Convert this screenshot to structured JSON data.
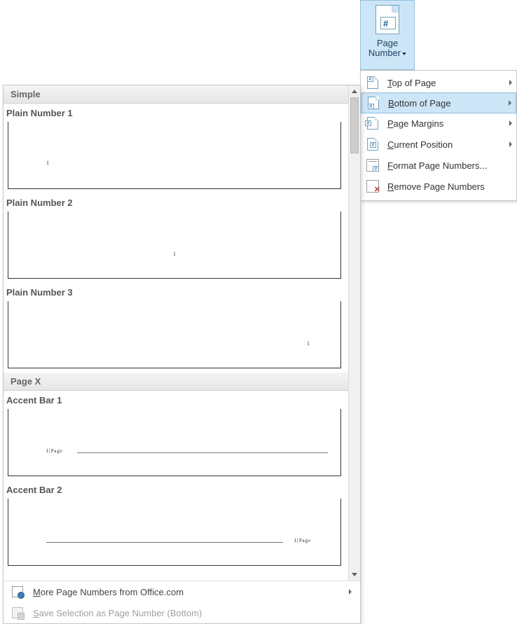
{
  "ribbon": {
    "button_line1": "Page",
    "button_line2": "Number",
    "icon_hash": "#"
  },
  "menu": {
    "items": [
      {
        "label": "Top of Page",
        "accel_index": 0,
        "submenu": true,
        "icon": "page-top"
      },
      {
        "label": "Bottom of Page",
        "accel_index": 0,
        "submenu": true,
        "icon": "page-bottom",
        "highlighted": true
      },
      {
        "label": "Page Margins",
        "accel_index": 0,
        "submenu": true,
        "icon": "page-margin"
      },
      {
        "label": "Current Position",
        "accel_index": 0,
        "submenu": true,
        "icon": "page-current"
      },
      {
        "label": "Format Page Numbers...",
        "accel_index": 0,
        "submenu": false,
        "icon": "format"
      },
      {
        "label": "Remove Page Numbers",
        "accel_index": 0,
        "submenu": false,
        "icon": "remove"
      }
    ]
  },
  "gallery": {
    "sections": [
      {
        "header": "Simple",
        "items": [
          {
            "title": "Plain Number 1",
            "style": "plain-left",
            "sample": "1"
          },
          {
            "title": "Plain Number 2",
            "style": "plain-center",
            "sample": "1"
          },
          {
            "title": "Plain Number 3",
            "style": "plain-right",
            "sample": "1"
          }
        ]
      },
      {
        "header": "Page X",
        "items": [
          {
            "title": "Accent Bar 1",
            "style": "accent-left",
            "sample": "1|Page"
          },
          {
            "title": "Accent Bar 2",
            "style": "accent-right",
            "sample": "1|Page"
          }
        ]
      }
    ],
    "footer_more": "More Page Numbers from Office.com",
    "footer_save": "Save Selection as Page Number (Bottom)"
  },
  "icon_hash": "#"
}
